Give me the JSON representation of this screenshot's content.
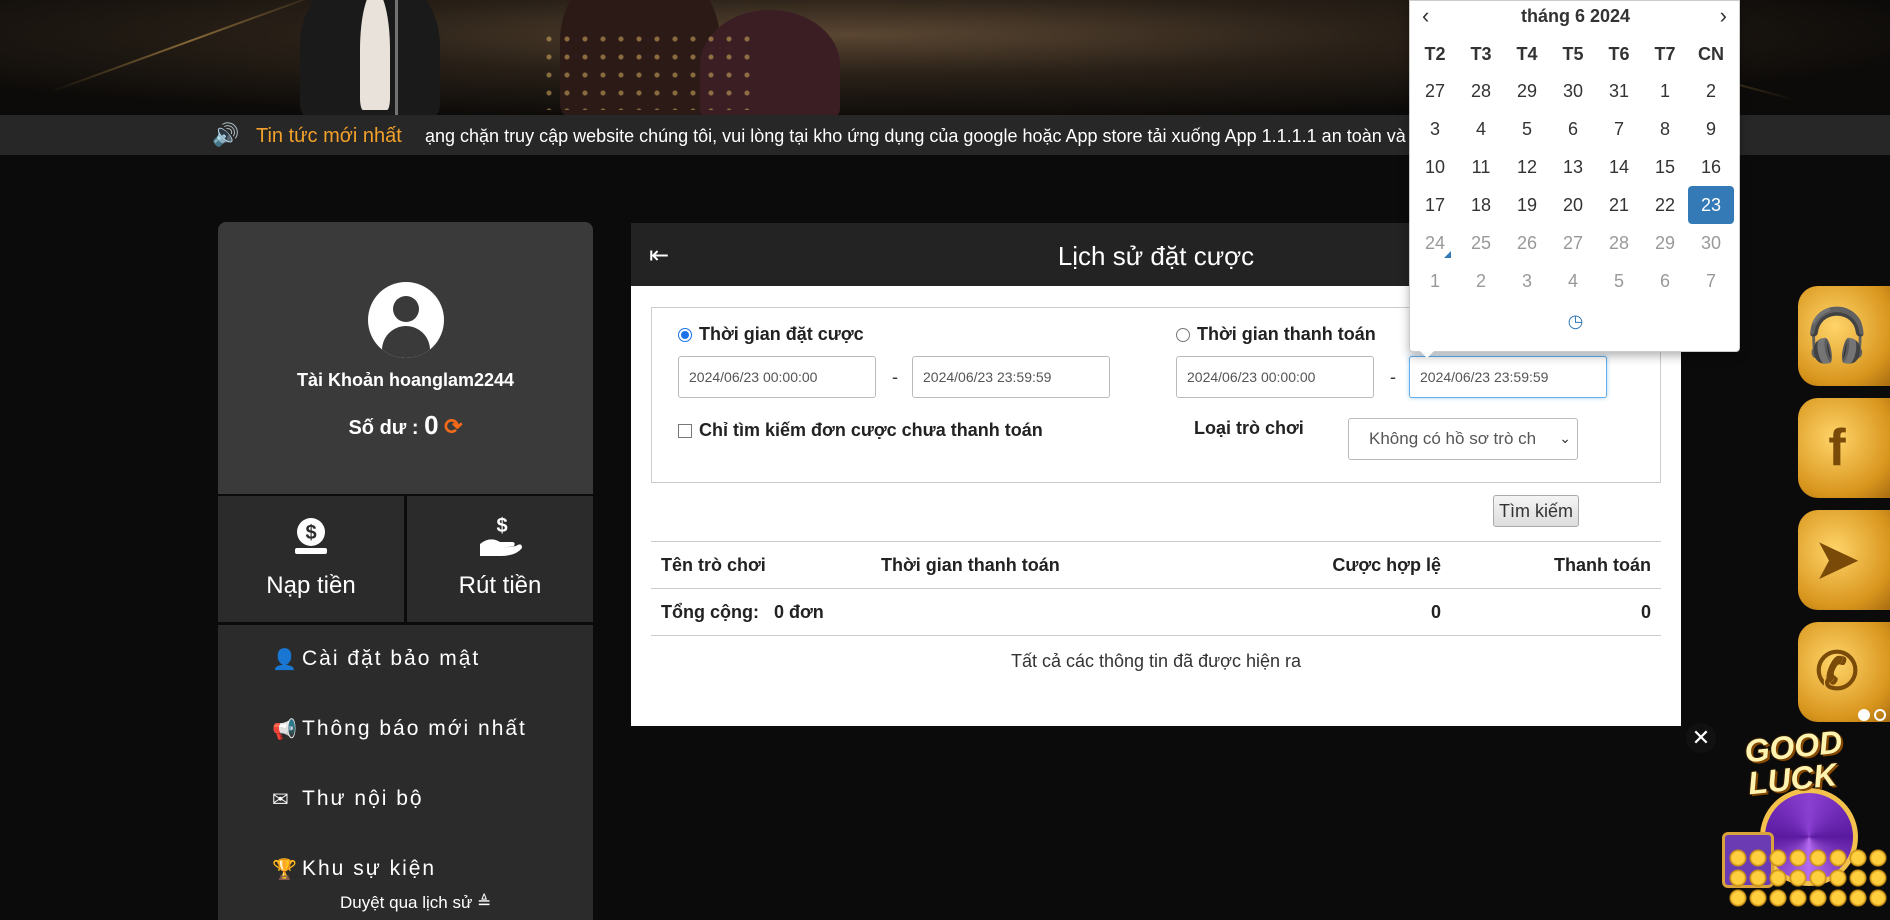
{
  "ticker": {
    "label": "Tin tức mới nhất",
    "text": "ạng chặn truy cập website chúng tôi, vui lòng tại kho ứng dụng của google hoặc App store tải xuống App 1.1.1.1 an toàn và bảo"
  },
  "account": {
    "account_label": "Tài Khoản hoanglam2244",
    "balance_label": "Số dư : ",
    "balance_value": "0"
  },
  "actions": {
    "deposit": "Nạp tiền",
    "withdraw": "Rút tiền"
  },
  "menu": {
    "items": [
      {
        "label": "Cài đặt bảo mật",
        "icon": "user-lock-icon"
      },
      {
        "label": "Thông báo mới nhất",
        "icon": "megaphone-icon"
      },
      {
        "label": "Thư nội bộ",
        "icon": "envelope-icon"
      },
      {
        "label": "Khu sự kiện",
        "icon": "trophy-icon"
      }
    ]
  },
  "browse_history": "Duyệt qua lịch sử ≜",
  "main": {
    "title": "Lịch sử đặt cược",
    "radio_bet_time": "Thời gian đặt cược",
    "radio_pay_time": "Thời gian thanh toán",
    "bet_from": "2024/06/23 00:00:00",
    "bet_to": "2024/06/23 23:59:59",
    "pay_from": "2024/06/23 00:00:00",
    "pay_to": "2024/06/23 23:59:59",
    "dash": "-",
    "unpaid_only": "Chỉ tìm kiếm đơn cược chưa thanh toán",
    "game_type_label": "Loại trò chơi",
    "game_type_value": "Không có hồ sơ trò ch",
    "search_button": "Tìm kiếm",
    "table": {
      "headers": [
        "Tên trò chơi",
        "Thời gian thanh toán",
        "Cược hợp lệ",
        "Thanh toán"
      ],
      "total_label": "Tổng cộng:",
      "total_count": "0 đơn",
      "total_valid": "0",
      "total_payout": "0"
    },
    "all_shown": "Tất cả các thông tin đã được hiện ra"
  },
  "calendar": {
    "month_title": "tháng 6 2024",
    "weekdays": [
      "T2",
      "T3",
      "T4",
      "T5",
      "T6",
      "T7",
      "CN"
    ],
    "weeks": [
      [
        "27",
        "28",
        "29",
        "30",
        "31",
        "1",
        "2"
      ],
      [
        "3",
        "4",
        "5",
        "6",
        "7",
        "8",
        "9"
      ],
      [
        "10",
        "11",
        "12",
        "13",
        "14",
        "15",
        "16"
      ],
      [
        "17",
        "18",
        "19",
        "20",
        "21",
        "22",
        "23"
      ],
      [
        "24",
        "25",
        "26",
        "27",
        "28",
        "29",
        "30"
      ],
      [
        "1",
        "2",
        "3",
        "4",
        "5",
        "6",
        "7"
      ]
    ],
    "selected": "23",
    "accent_color": "#337ab7"
  },
  "colors": {
    "ticker_accent": "#f3a12a",
    "refresh": "#f36b1a",
    "gold": "#e8a93a"
  },
  "side_buttons": [
    "support-headset-icon",
    "facebook-icon",
    "telegram-icon",
    "phone-icon"
  ],
  "promo": {
    "text": "GOOD LUCK"
  }
}
